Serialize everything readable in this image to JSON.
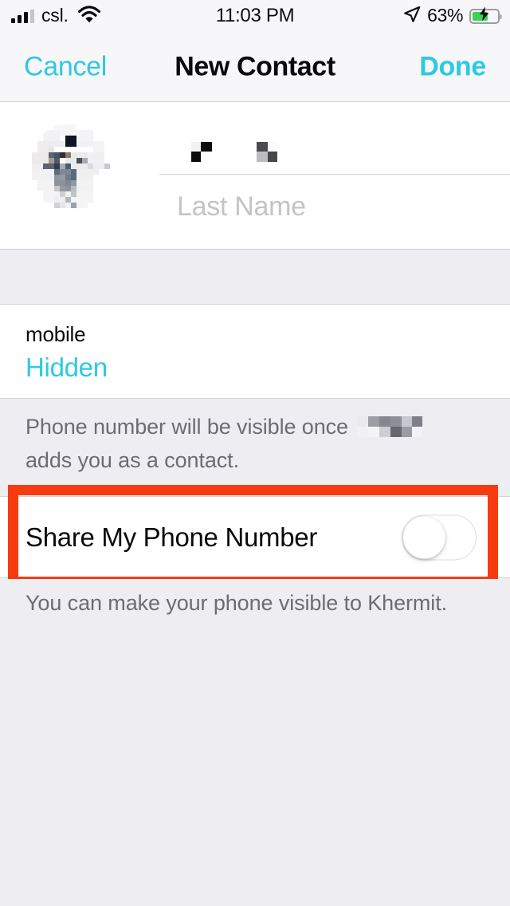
{
  "status_bar": {
    "carrier": "csl.",
    "time": "11:03 PM",
    "battery_percent": "63%",
    "signal_icon": "signal-bars-icon",
    "wifi_icon": "wifi-icon",
    "location_icon": "location-arrow-icon",
    "battery_icon": "battery-charging-icon",
    "battery_level": 60,
    "battery_color": "#3ad35a"
  },
  "nav_bar": {
    "cancel_label": "Cancel",
    "title": "New Contact",
    "done_label": "Done",
    "tint_color": "#2ec9e2"
  },
  "contact_header": {
    "avatar_name": "contact-photo",
    "first_name_value": "",
    "first_name_redacted": true,
    "last_name_placeholder": "Last Name",
    "last_name_value": ""
  },
  "phone_section": {
    "label": "mobile",
    "value": "Hidden",
    "value_color": "#2ec9e2"
  },
  "notes": {
    "phone_visibility_note_part1": "Phone number will be visible once",
    "phone_visibility_note_redacted_name": true,
    "phone_visibility_note_part2": "adds you as a contact.",
    "share_note": "You can make your phone visible to Khermit."
  },
  "share_toggle": {
    "label": "Share My Phone Number",
    "state": "off"
  },
  "annotation": {
    "type": "highlight-rectangle",
    "color": "#f73b10",
    "targets": "share-my-phone-number-row"
  }
}
